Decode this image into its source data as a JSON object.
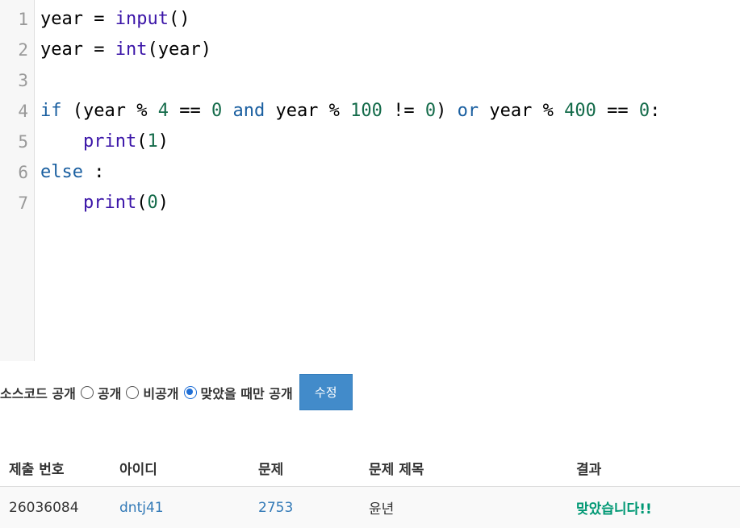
{
  "editor": {
    "line_numbers": [
      "1",
      "2",
      "3",
      "4",
      "5",
      "6",
      "7"
    ],
    "lines": [
      [
        {
          "t": "year = ",
          "c": ""
        },
        {
          "t": "input",
          "c": "bi"
        },
        {
          "t": "()",
          "c": ""
        }
      ],
      [
        {
          "t": "year = ",
          "c": ""
        },
        {
          "t": "int",
          "c": "bi"
        },
        {
          "t": "(year)",
          "c": ""
        }
      ],
      [],
      [
        {
          "t": "if",
          "c": "kw"
        },
        {
          "t": " (year % ",
          "c": ""
        },
        {
          "t": "4",
          "c": "num"
        },
        {
          "t": " == ",
          "c": ""
        },
        {
          "t": "0",
          "c": "num"
        },
        {
          "t": " ",
          "c": ""
        },
        {
          "t": "and",
          "c": "kw"
        },
        {
          "t": " year % ",
          "c": ""
        },
        {
          "t": "100",
          "c": "num"
        },
        {
          "t": " != ",
          "c": ""
        },
        {
          "t": "0",
          "c": "num"
        },
        {
          "t": ") ",
          "c": ""
        },
        {
          "t": "or",
          "c": "kw"
        },
        {
          "t": " year % ",
          "c": ""
        },
        {
          "t": "400",
          "c": "num"
        },
        {
          "t": " == ",
          "c": ""
        },
        {
          "t": "0",
          "c": "num"
        },
        {
          "t": ":",
          "c": ""
        }
      ],
      [
        {
          "t": "    ",
          "c": ""
        },
        {
          "t": "print",
          "c": "bi"
        },
        {
          "t": "(",
          "c": ""
        },
        {
          "t": "1",
          "c": "num"
        },
        {
          "t": ")",
          "c": ""
        }
      ],
      [
        {
          "t": "else",
          "c": "kw"
        },
        {
          "t": " :",
          "c": ""
        }
      ],
      [
        {
          "t": "    ",
          "c": ""
        },
        {
          "t": "print",
          "c": "bi"
        },
        {
          "t": "(",
          "c": ""
        },
        {
          "t": "0",
          "c": "num"
        },
        {
          "t": ")",
          "c": ""
        }
      ]
    ]
  },
  "visibility": {
    "label": "소스코드 공개",
    "options": [
      {
        "label": "공개",
        "checked": false
      },
      {
        "label": "비공개",
        "checked": false
      },
      {
        "label": "맞았을 때만 공개",
        "checked": true
      }
    ],
    "submit_label": "수정"
  },
  "table": {
    "headers": [
      "제출 번호",
      "아이디",
      "문제",
      "문제 제목",
      "결과"
    ],
    "rows": [
      {
        "submission_id": "26036084",
        "user_id": "dntj41",
        "problem": "2753",
        "title": "윤년",
        "result": "맞았습니다!!"
      }
    ]
  },
  "colors": {
    "accent": "#428bca",
    "link": "#337ab7",
    "success": "#009874"
  }
}
